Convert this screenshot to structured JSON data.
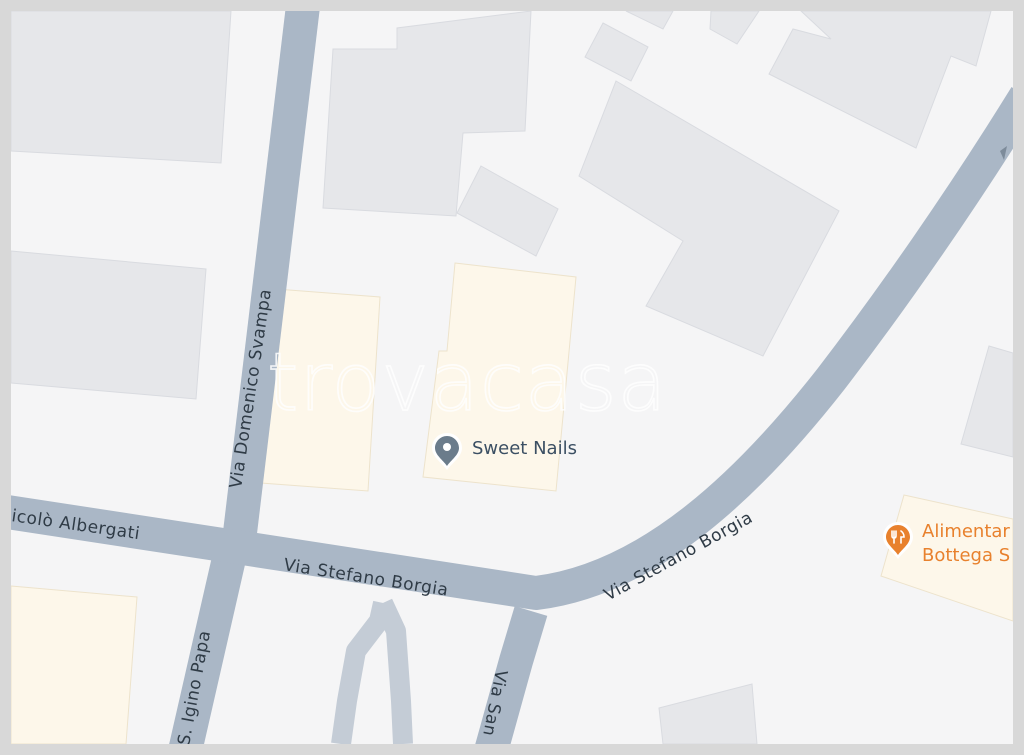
{
  "map": {
    "watermark": "trovacasa",
    "streets": {
      "domenico_svampa": "Via Domenico Svampa",
      "niccolo_albergati": "icolò Albergati",
      "stefano_borgia_west": "Via Stefano Borgia",
      "stefano_borgia_east": "Via Stefano Borgia",
      "igino_papa": "S. Igino Papa",
      "via_san": "Via San"
    },
    "pois": [
      {
        "label": "Sweet Nails",
        "icon": "location-pin-icon",
        "color": "#6b7c8b"
      },
      {
        "label_line1": "Alimentar",
        "label_line2": "Bottega S",
        "icon": "restaurant-icon",
        "color": "#e8812d"
      }
    ],
    "colors": {
      "road": "#aab7c6",
      "background": "#f5f5f6",
      "building": "#e6e7ea",
      "highlight_building": "#fdf7ea"
    }
  }
}
